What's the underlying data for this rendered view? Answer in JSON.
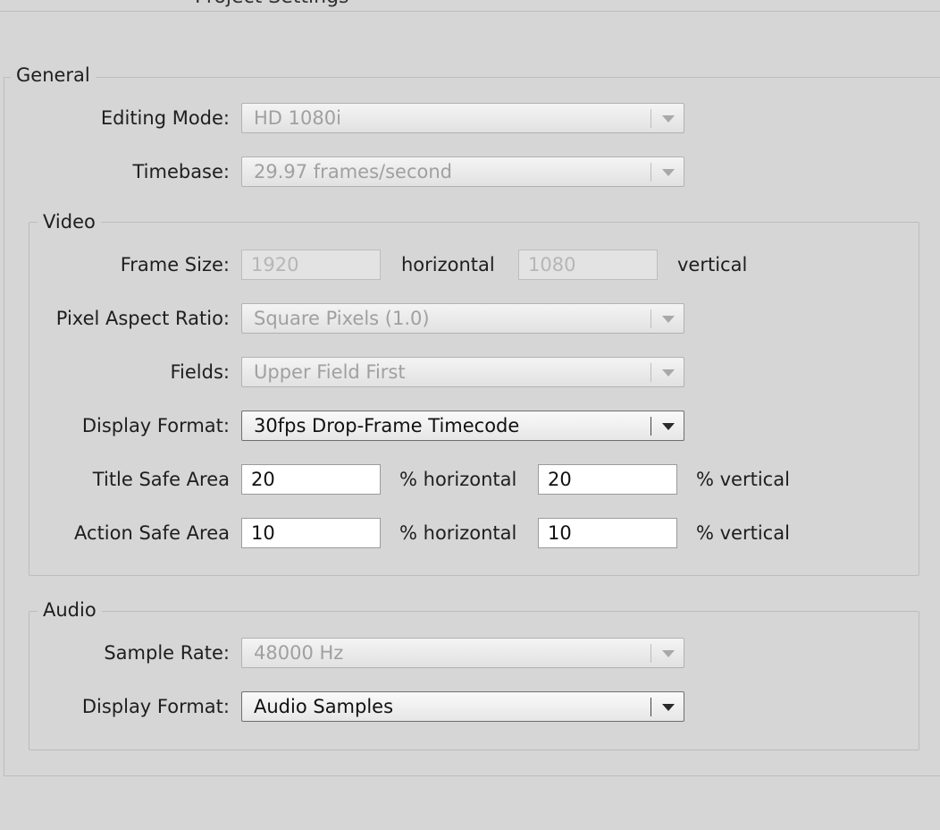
{
  "window": {
    "title": "Project Settings"
  },
  "general": {
    "legend": "General",
    "editing_mode": {
      "label": "Editing Mode:",
      "value": "HD 1080i"
    },
    "timebase": {
      "label": "Timebase:",
      "value": "29.97 frames/second"
    }
  },
  "video": {
    "legend": "Video",
    "frame_size": {
      "label": "Frame Size:",
      "horizontal": "1920",
      "horizontal_unit": "horizontal",
      "vertical": "1080",
      "vertical_unit": "vertical"
    },
    "pixel_aspect_ratio": {
      "label": "Pixel Aspect Ratio:",
      "value": "Square Pixels (1.0)"
    },
    "fields": {
      "label": "Fields:",
      "value": "Upper Field First"
    },
    "display_format": {
      "label": "Display Format:",
      "value": "30fps Drop-Frame Timecode"
    },
    "title_safe": {
      "label": "Title Safe Area",
      "horizontal": "20",
      "horizontal_unit": "% horizontal",
      "vertical": "20",
      "vertical_unit": "% vertical"
    },
    "action_safe": {
      "label": "Action Safe Area",
      "horizontal": "10",
      "horizontal_unit": "% horizontal",
      "vertical": "10",
      "vertical_unit": "% vertical"
    }
  },
  "audio": {
    "legend": "Audio",
    "sample_rate": {
      "label": "Sample Rate:",
      "value": "48000 Hz"
    },
    "display_format": {
      "label": "Display Format:",
      "value": "Audio Samples"
    }
  },
  "icons": {
    "dropdown": "chevron-down-icon"
  }
}
